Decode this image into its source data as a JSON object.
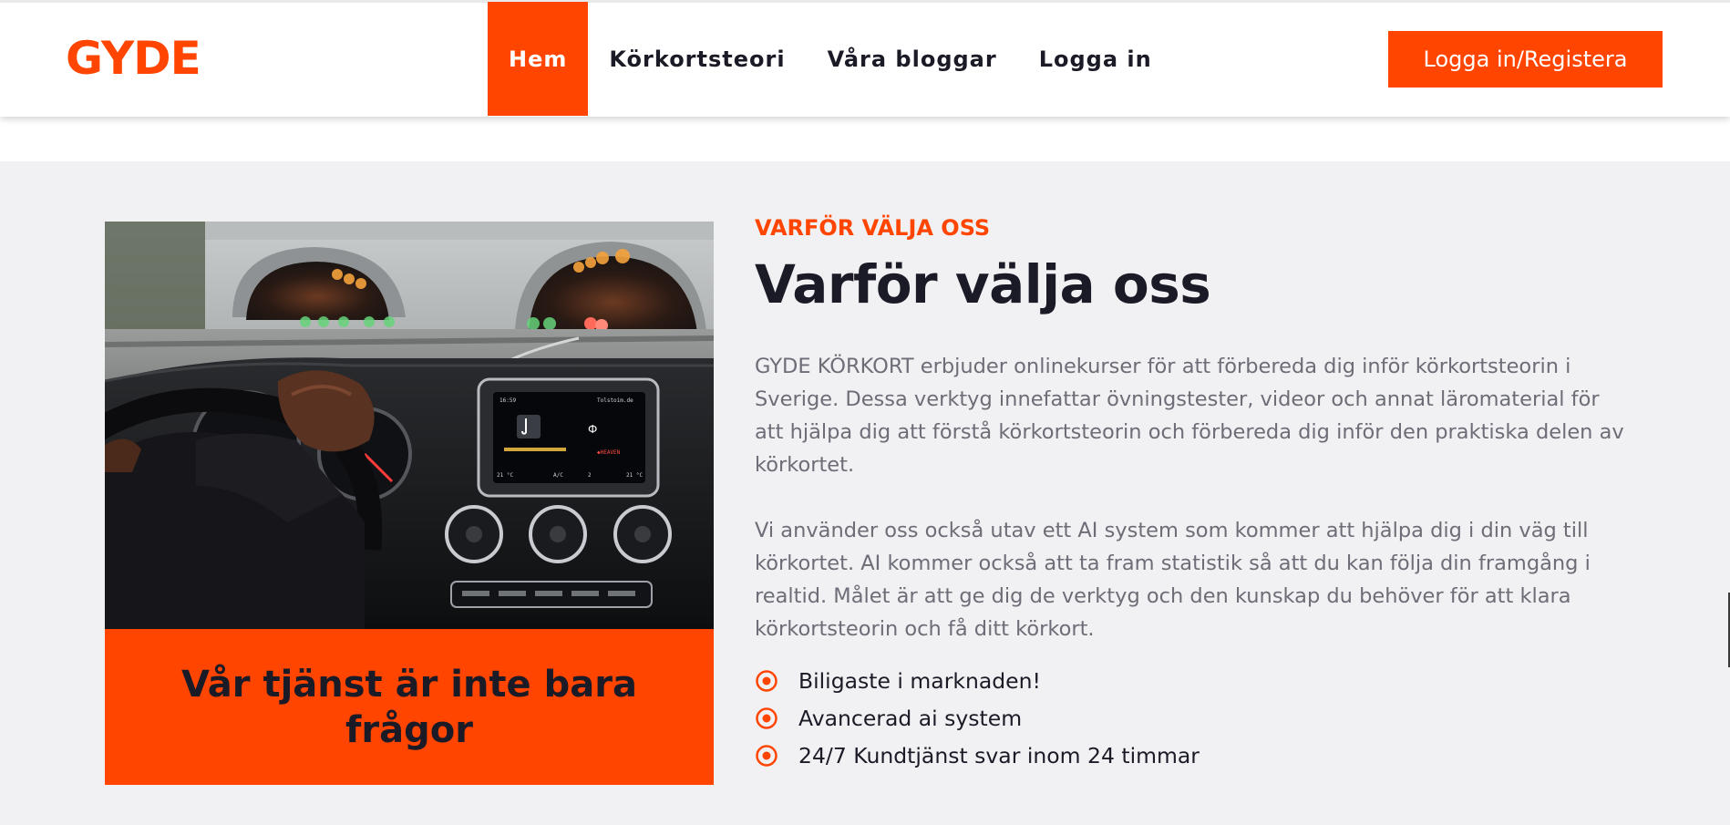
{
  "brand": {
    "logo": "GYDE",
    "accent": "#ff4500"
  },
  "nav": {
    "items": [
      {
        "label": "Hem",
        "active": true
      },
      {
        "label": "Körkortsteori",
        "active": false
      },
      {
        "label": "Våra bloggar",
        "active": false
      },
      {
        "label": "Logga in",
        "active": false
      }
    ],
    "cta": "Logga in/Registera"
  },
  "about": {
    "eyebrow": "VARFÖR VÄLJA OSS",
    "title": "Varför välja oss",
    "paragraphs": [
      "GYDE KÖRKORT erbjuder onlinekurser för att förbereda dig inför körkortsteorin i Sverige. Dessa verktyg innefattar övningstester, videor och annat läromaterial för att hjälpa dig att förstå körkortsteorin och förbereda dig inför den praktiska delen av körkortet.",
      "Vi använder oss också utav ett AI system som kommer att hjälpa dig i din väg till körkortet. AI kommer också att ta fram statistik så att du kan följa din framgång i realtid. Målet är att ge dig de verktyg och den kunskap du behöver för att klara körkortsteorin och få ditt körkort."
    ],
    "features": [
      "Biligaste i marknaden!",
      "Avancerad ai system",
      "24/7 Kundtjänst svar inom 24 timmar"
    ],
    "feature_icon": "radio-dot-icon"
  },
  "image": {
    "caption": "Vår tjänst är inte bara frågor",
    "screen_text": {
      "clock": "16:59",
      "source": "Tolstoim.de",
      "state": "Ф",
      "nav": "◆HEAVEN",
      "temp_left": "21 °C",
      "temp_right": "21 °C",
      "fan": "A/C",
      "fan_level": "2"
    }
  }
}
